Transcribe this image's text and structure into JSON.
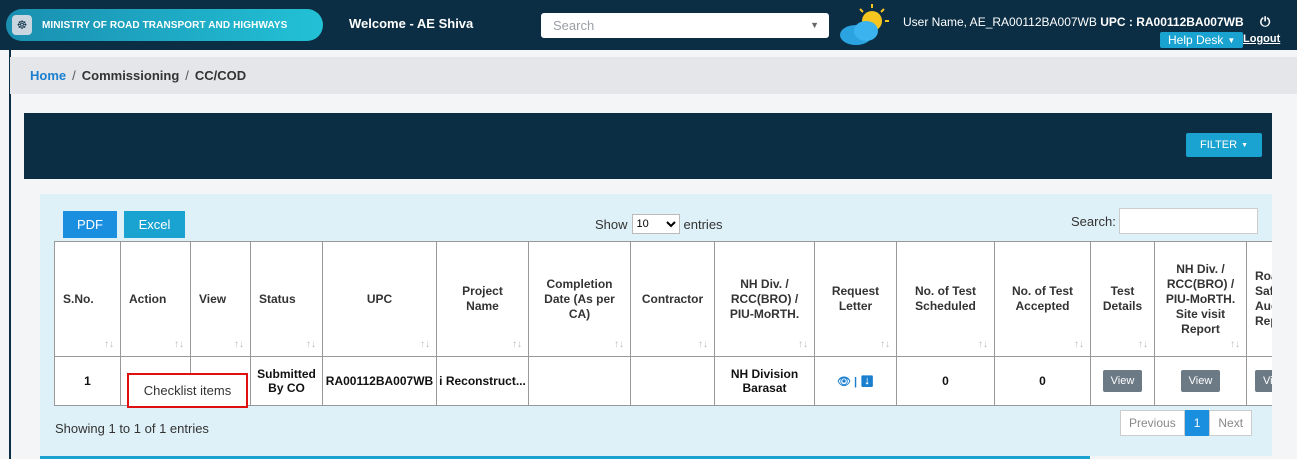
{
  "header": {
    "ministry": "MINISTRY OF ROAD TRANSPORT AND HIGHWAYS",
    "welcome": "Welcome - AE Shiva",
    "search_placeholder": "Search",
    "user_label": "User Name, AE_RA00112BA007WB",
    "upc_label": "UPC : RA00112BA007WB",
    "helpdesk": "Help Desk",
    "logout": "Logout"
  },
  "breadcrumb": {
    "home": "Home",
    "sep1": "/",
    "item1": "Commissioning",
    "sep2": "/",
    "item2": "CC/COD"
  },
  "panel": {
    "filter": "FILTER"
  },
  "toolbar": {
    "pdf": "PDF",
    "excel": "Excel",
    "show": "Show",
    "entries_value": "10",
    "entries": "entries",
    "search": "Search:"
  },
  "table": {
    "headers": [
      "S.No.",
      "Action",
      "View",
      "Status",
      "UPC",
      "Project Name",
      "Completion Date (As per CA)",
      "Contractor",
      "NH Div. / RCC(BRO) / PIU-MoRTH.",
      "Request Letter",
      "No. of Test Scheduled",
      "No. of Test Accepted",
      "Test Details",
      "NH Div. / RCC(BRO) / PIU-MoRTH. Site visit Report",
      "Road Safety Audit Report"
    ],
    "row": {
      "sno": "1",
      "status": "Submitted By CO",
      "upc": "RA00112BA007WB",
      "project": "i Reconstruct...",
      "completion": "",
      "contractor": "",
      "nhdiv": "NH Division Barasat",
      "scheduled": "0",
      "accepted": "0",
      "view_label": "View"
    }
  },
  "popup": "Checklist items",
  "footer": {
    "showing": "Showing 1 to 1 of 1 entries",
    "previous": "Previous",
    "page": "1",
    "next": "Next"
  }
}
